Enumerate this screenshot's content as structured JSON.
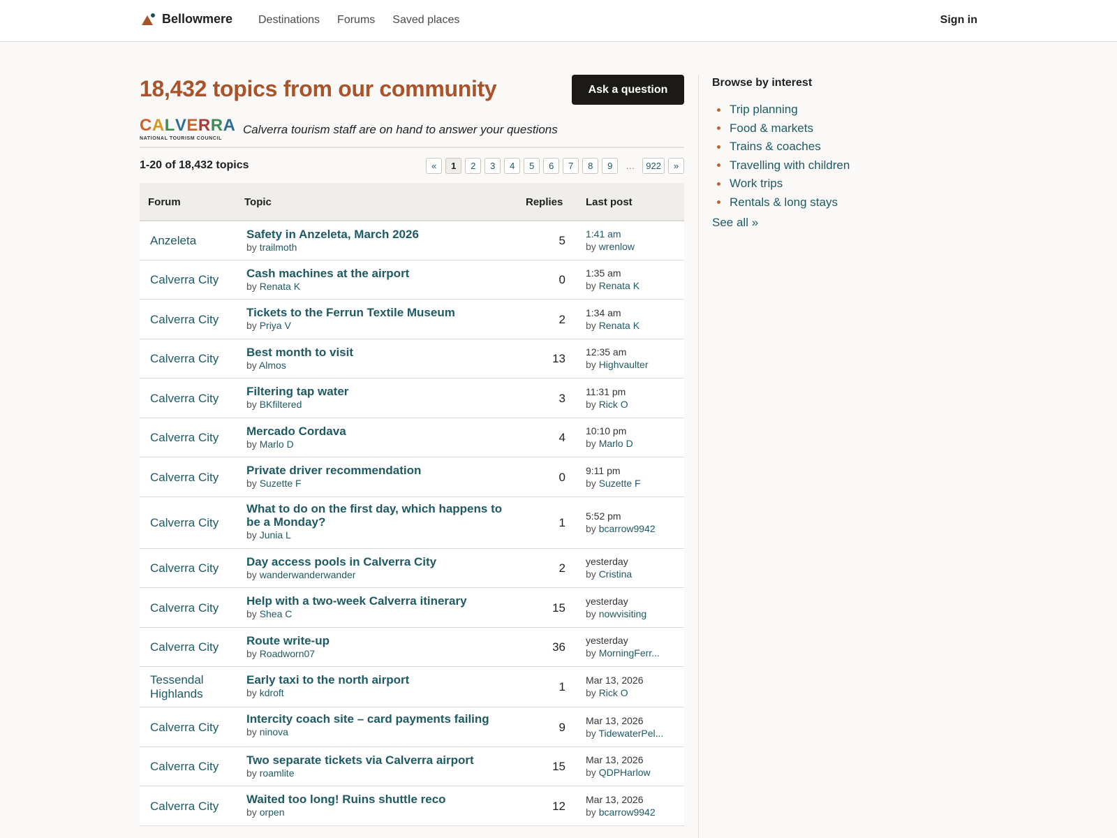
{
  "header": {
    "brand": "Bellowmere",
    "nav": [
      "Destinations",
      "Forums",
      "Saved places"
    ],
    "sign_in": "Sign in"
  },
  "main": {
    "title": "18,432 topics from our community",
    "ask_button": "Ask a question",
    "sponsor": {
      "logo_letters": [
        "C",
        "A",
        "L",
        "V",
        "E",
        "R",
        "R",
        "A"
      ],
      "logo_colors": [
        "#c9622c",
        "#d19a1f",
        "#3f8a55",
        "#2f6f8d",
        "#c9622c",
        "#a43e3a",
        "#3f8a55",
        "#2f6f8d"
      ],
      "logo_subtitle": "NATIONAL TOURISM COUNCIL",
      "text": "Calverra tourism staff are on hand to answer your questions"
    },
    "count": "1-20 of 18,432 topics",
    "pager": {
      "prev": "«",
      "pages": [
        "1",
        "2",
        "3",
        "4",
        "5",
        "6",
        "7",
        "8",
        "9"
      ],
      "current": "1",
      "ellipsis": "…",
      "last": "922",
      "next": "»"
    },
    "table": {
      "headers": {
        "forum": "Forum",
        "topic": "Topic",
        "replies": "Replies",
        "last_post": "Last post"
      },
      "by_prefix": "by",
      "rows": [
        {
          "forum": "Anzeleta",
          "title": "Safety in Anzeleta, March 2026",
          "author": "trailmoth",
          "replies": "5",
          "last_time": "1:41 am",
          "last_author": "wrenlow"
        },
        {
          "forum": "Calverra City",
          "title": "Cash machines at the airport",
          "author": "Renata K",
          "replies": "0",
          "last_time": "1:35 am",
          "last_author": "Renata K"
        },
        {
          "forum": "Calverra City",
          "title": "Tickets to the Ferrun Textile Museum",
          "author": "Priya V",
          "replies": "2",
          "last_time": "1:34 am",
          "last_author": "Renata K"
        },
        {
          "forum": "Calverra City",
          "title": "Best month to visit",
          "author": "Almos",
          "replies": "13",
          "last_time": "12:35 am",
          "last_author": "Highvaulter"
        },
        {
          "forum": "Calverra City",
          "title": "Filtering tap water",
          "author": "BKfiltered",
          "replies": "3",
          "last_time": "11:31 pm",
          "last_author": "Rick O"
        },
        {
          "forum": "Calverra City",
          "title": "Mercado Cordava",
          "author": "Marlo D",
          "replies": "4",
          "last_time": "10:10 pm",
          "last_author": "Marlo D"
        },
        {
          "forum": "Calverra City",
          "title": "Private driver recommendation",
          "author": "Suzette F",
          "replies": "0",
          "last_time": "9:11 pm",
          "last_author": "Suzette F"
        },
        {
          "forum": "Calverra City",
          "title": "What to do on the first day, which happens to be a Monday?",
          "author": "Junia L",
          "replies": "1",
          "last_time": "5:52 pm",
          "last_author": "bcarrow9942"
        },
        {
          "forum": "Calverra City",
          "title": "Day access pools in Calverra City",
          "author": "wanderwanderwander",
          "replies": "2",
          "last_time": "yesterday",
          "last_author": "Cristina"
        },
        {
          "forum": "Calverra City",
          "title": "Help with a two-week Calverra itinerary",
          "author": "Shea C",
          "replies": "15",
          "last_time": "yesterday",
          "last_author": "nowvisiting"
        },
        {
          "forum": "Calverra City",
          "title": "Route write-up",
          "author": "Roadworn07",
          "replies": "36",
          "last_time": "yesterday",
          "last_author": "MorningFerr..."
        },
        {
          "forum": "Tessendal Highlands",
          "title": "Early taxi to the north airport",
          "author": "kdroft",
          "replies": "1",
          "last_time": "Mar 13, 2026",
          "last_author": "Rick O"
        },
        {
          "forum": "Calverra City",
          "title": "Intercity coach site – card payments failing",
          "author": "ninova",
          "replies": "9",
          "last_time": "Mar 13, 2026",
          "last_author": "TidewaterPel..."
        },
        {
          "forum": "Calverra City",
          "title": "Two separate tickets via Calverra airport",
          "author": "roamlite",
          "replies": "15",
          "last_time": "Mar 13, 2026",
          "last_author": "QDPHarlow"
        },
        {
          "forum": "Calverra City",
          "title": "Waited too long! Ruins shuttle reco",
          "author": "orpen",
          "replies": "12",
          "last_time": "Mar 13, 2026",
          "last_author": "bcarrow9942"
        }
      ]
    }
  },
  "sidebar": {
    "title": "Browse by interest",
    "items": [
      "Trip planning",
      "Food & markets",
      "Trains & coaches",
      "Travelling with children",
      "Work trips",
      "Rentals & long stays"
    ],
    "see_all": "See all »"
  },
  "colors": {
    "accent": "#a8532a",
    "link": "#1e5a63",
    "button": "#1c1a17"
  }
}
